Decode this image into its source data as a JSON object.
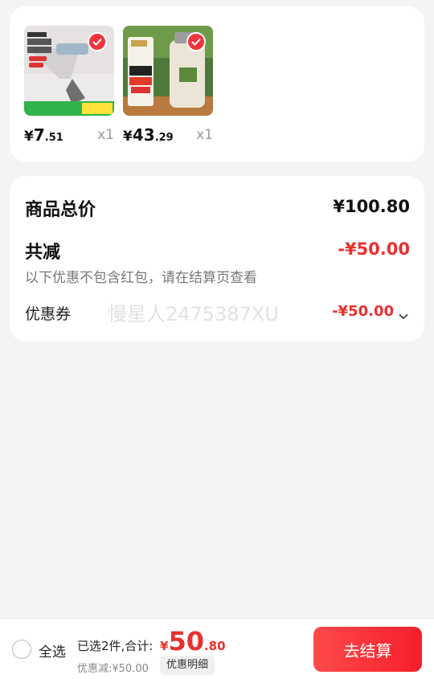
{
  "products": [
    {
      "price_symbol": "¥",
      "price_int": "7",
      "price_dec": ".51",
      "quantity": "x1",
      "icon": "product-thumb-dispenser"
    },
    {
      "price_symbol": "¥",
      "price_int": "43",
      "price_dec": ".29",
      "quantity": "x1",
      "icon": "product-thumb-bottle"
    }
  ],
  "summary": {
    "total_label": "商品总价",
    "total_value": "¥100.80",
    "reduce_label": "共减",
    "reduce_value": "-¥50.00",
    "reduce_note": "以下优惠不包含红包，请在结算页查看",
    "coupon_label": "优惠券",
    "coupon_value": "-¥50.00",
    "watermark": "慢星人2475387XU"
  },
  "bottom_bar": {
    "select_all_label": "全选",
    "selected_text": "已选2件,合计:",
    "sum_symbol": "¥",
    "sum_int": "50",
    "sum_dec": ".80",
    "discount_text": "优惠减:¥50.00",
    "detail_label": "优惠明细",
    "checkout_label": "去结算"
  },
  "colors": {
    "accent": "#e8312f",
    "checkout_start": "#ff4a4a",
    "checkout_end": "#f41f2a",
    "page_bg": "#f4f4f4"
  }
}
